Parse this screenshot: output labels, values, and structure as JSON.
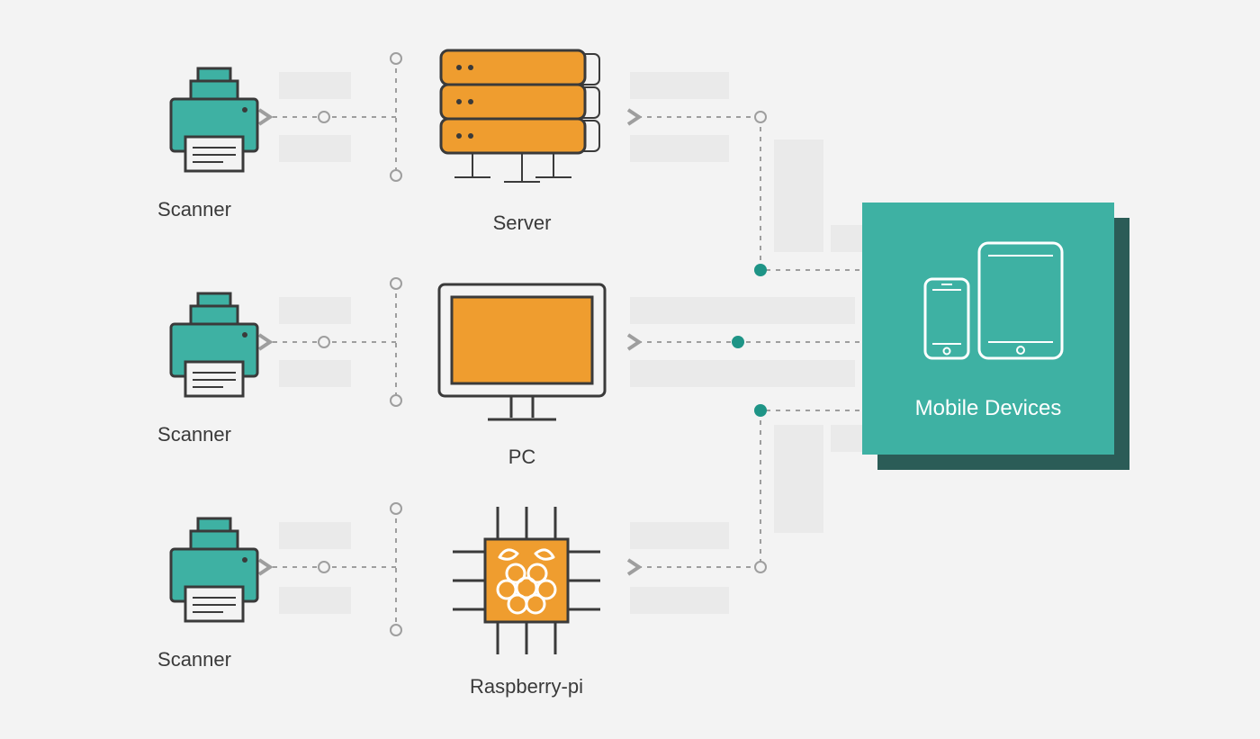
{
  "nodes": {
    "scanner1": {
      "label": "Scanner"
    },
    "scanner2": {
      "label": "Scanner"
    },
    "scanner3": {
      "label": "Scanner"
    },
    "server": {
      "label": "Server"
    },
    "pc": {
      "label": "PC"
    },
    "rpi": {
      "label": "Raspberry-pi"
    },
    "mobile": {
      "label": "Mobile Devices"
    }
  },
  "colors": {
    "teal": "#3eb1a3",
    "tealDark": "#2b5c57",
    "orange": "#ef9d2f",
    "stroke": "#3a3a3a",
    "placeholder": "#eaeaea",
    "connector": "#9e9e9e"
  }
}
